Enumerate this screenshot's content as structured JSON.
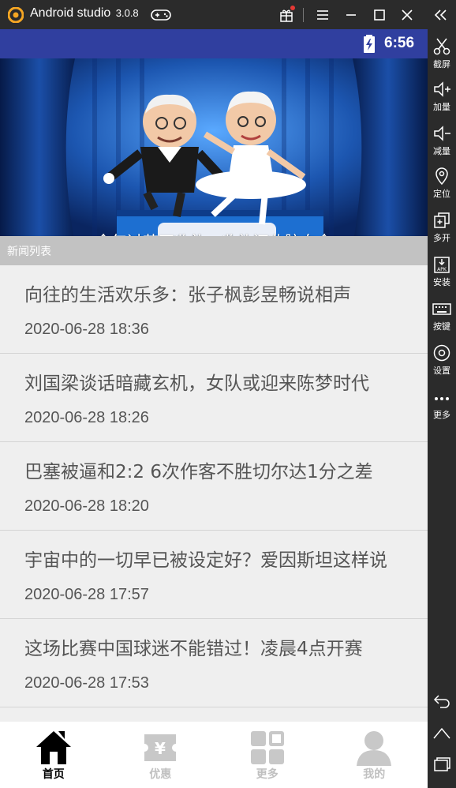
{
  "window": {
    "app_name": "Android studio",
    "version": "3.0.8"
  },
  "toolbar": {
    "items": [
      {
        "label": "截屏",
        "icon": "scissors-icon"
      },
      {
        "label": "加量",
        "icon": "volume-up-icon"
      },
      {
        "label": "减量",
        "icon": "volume-down-icon"
      },
      {
        "label": "定位",
        "icon": "location-icon"
      },
      {
        "label": "多开",
        "icon": "multi-instance-icon"
      },
      {
        "label": "安装",
        "icon": "apk-install-icon"
      },
      {
        "label": "按键",
        "icon": "keyboard-icon"
      },
      {
        "label": "设置",
        "icon": "gear-icon"
      },
      {
        "label": "更多",
        "icon": "more-dots-icon"
      }
    ]
  },
  "statusbar": {
    "time": "6:56"
  },
  "banner": {
    "caption": "今年过节不收礼，收礼还收脑白金",
    "slide_count": 5
  },
  "section": {
    "title": "新闻列表"
  },
  "news": [
    {
      "title": "向往的生活欢乐多：张子枫彭昱畅说相声",
      "date": "2020-06-28 18:36"
    },
    {
      "title": "刘国梁谈话暗藏玄机，女队或迎来陈梦时代",
      "date": "2020-06-28 18:26"
    },
    {
      "title": "巴塞被逼和2:2 6次作客不胜切尔达1分之差",
      "date": "2020-06-28 18:20"
    },
    {
      "title": "宇宙中的一切早已被设定好？爱因斯坦这样说",
      "date": "2020-06-28 17:57"
    },
    {
      "title": "这场比赛中国球迷不能错过！凌晨4点开赛",
      "date": "2020-06-28 17:53"
    }
  ],
  "bottom_nav": {
    "home": "首页",
    "discount": "优惠",
    "more": "更多",
    "mine": "我的"
  },
  "colors": {
    "statusbar": "#303f9f",
    "section_header": "#c2c2c2",
    "list_bg": "#efefef",
    "emulator_chrome": "#2b2b2b",
    "logo_orange": "#f5a623"
  }
}
